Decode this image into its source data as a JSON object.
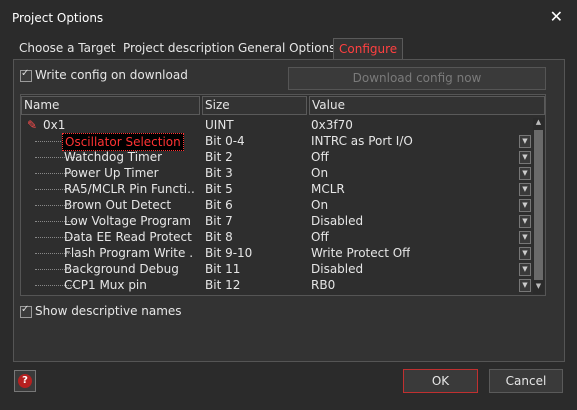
{
  "window": {
    "title": "Project Options",
    "close_icon": "close-icon"
  },
  "tabs": [
    {
      "label": "Choose a Target",
      "active": false
    },
    {
      "label": "Project description",
      "active": false
    },
    {
      "label": "General Options",
      "active": false
    },
    {
      "label": "Configure",
      "active": true
    }
  ],
  "configure": {
    "write_on_download_label": "Write config on download",
    "write_on_download_checked": true,
    "download_now_label": "Download config now",
    "show_descriptive_label": "Show descriptive names",
    "show_descriptive_checked": true
  },
  "grid": {
    "columns": [
      "Name",
      "Size",
      "Value"
    ],
    "root": {
      "name": "0x1",
      "size": "UINT",
      "value": "0x3f70"
    },
    "rows": [
      {
        "name": "Oscillator Selection",
        "size": "Bit 0-4",
        "value": "INTRC as Port I/O"
      },
      {
        "name": "Watchdog Timer",
        "size": "Bit 2",
        "value": "Off"
      },
      {
        "name": "Power Up Timer",
        "size": "Bit 3",
        "value": "On"
      },
      {
        "name": "RA5/MCLR Pin Functi...",
        "size": "Bit 5",
        "value": "MCLR"
      },
      {
        "name": "Brown Out Detect",
        "size": "Bit 6",
        "value": "On"
      },
      {
        "name": "Low Voltage Program",
        "size": "Bit 7",
        "value": "Disabled"
      },
      {
        "name": "Data EE Read Protect",
        "size": "Bit 8",
        "value": "Off"
      },
      {
        "name": "Flash Program Write ...",
        "size": "Bit 9-10",
        "value": "Write Protect Off"
      },
      {
        "name": "Background Debug",
        "size": "Bit 11",
        "value": "Disabled"
      },
      {
        "name": "CCP1 Mux pin",
        "size": "Bit 12",
        "value": "RB0"
      }
    ]
  },
  "footer": {
    "ok_label": "OK",
    "cancel_label": "Cancel"
  },
  "colors": {
    "accent": "#ff3333",
    "background": "#2b2b2b",
    "panel": "#333333"
  }
}
